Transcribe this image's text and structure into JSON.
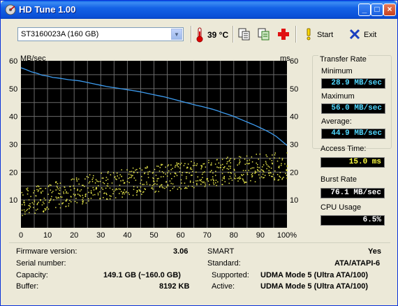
{
  "window": {
    "title": "HD Tune 1.00",
    "min_label": "_",
    "max_label": "□",
    "close_label": "×"
  },
  "toolbar": {
    "drive": "ST3160023A (160 GB)",
    "temperature": "39 °C",
    "start_label": "Start",
    "exit_label": "Exit"
  },
  "chart": {
    "left_unit": "MB/sec",
    "right_unit": "ms",
    "y_ticks": [
      "60",
      "50",
      "40",
      "30",
      "20",
      "10"
    ],
    "x_ticks": [
      "0",
      "10",
      "20",
      "30",
      "40",
      "50",
      "60",
      "70",
      "80",
      "90",
      "100%"
    ]
  },
  "chart_data": {
    "type": "line",
    "x": [
      0,
      2,
      4,
      6,
      8,
      10,
      12,
      14,
      16,
      18,
      20,
      22,
      24,
      26,
      28,
      30,
      32,
      34,
      36,
      38,
      40,
      42,
      44,
      46,
      48,
      50,
      52,
      54,
      56,
      58,
      60,
      62,
      64,
      66,
      68,
      70,
      72,
      74,
      76,
      78,
      80,
      82,
      84,
      86,
      88,
      90,
      92,
      94,
      96,
      98,
      100
    ],
    "series": [
      {
        "name": "Transfer Rate",
        "axis": "MB/sec",
        "values": [
          57.5,
          56.8,
          56.0,
          55.5,
          54.8,
          54.5,
          54.0,
          53.8,
          53.5,
          53.2,
          53.0,
          52.8,
          52.4,
          52.0,
          51.6,
          51.2,
          50.8,
          50.5,
          50.2,
          49.9,
          49.6,
          49.3,
          49.0,
          48.6,
          48.2,
          47.8,
          47.4,
          47.0,
          46.5,
          46.0,
          45.5,
          45.0,
          44.5,
          44.0,
          43.6,
          43.1,
          42.6,
          42.0,
          41.3,
          40.7,
          40.0,
          39.2,
          38.4,
          37.6,
          36.8,
          35.9,
          35.0,
          34.0,
          32.8,
          31.2,
          29.6
        ]
      },
      {
        "name": "Access Time",
        "axis": "ms",
        "values": [
          9.0,
          9.5,
          10.0,
          10.3,
          10.8,
          11.2,
          11.5,
          12.0,
          12.4,
          12.8,
          13.2,
          13.5,
          14.0,
          14.3,
          14.6,
          15.0,
          15.3,
          15.6,
          15.9,
          16.2,
          16.5,
          16.8,
          17.0,
          17.3,
          17.6,
          17.8,
          18.0,
          18.2,
          18.5,
          18.8,
          19.0,
          19.2,
          19.4,
          19.6,
          19.8,
          20.0,
          20.2,
          20.4,
          20.6,
          20.8,
          21.0,
          21.2,
          21.3,
          21.5,
          21.7,
          21.8,
          22.0,
          22.1,
          22.2,
          22.3,
          22.4
        ]
      }
    ],
    "ylim": [
      0,
      60
    ],
    "xlim": [
      0,
      100
    ],
    "ylabel": "MB/sec",
    "y2label": "ms",
    "grid": true
  },
  "side": {
    "transfer_rate_title": "Transfer Rate",
    "minimum_label": "Minimum",
    "minimum_value": "28.9 MB/sec",
    "maximum_label": "Maximum",
    "maximum_value": "56.0 MB/sec",
    "average_label": "Average:",
    "average_value": "44.9 MB/sec",
    "access_label": "Access Time:",
    "access_value": "15.0 ms",
    "burst_label": "Burst Rate",
    "burst_value": "76.1 MB/sec",
    "cpu_label": "CPU Usage",
    "cpu_value": "6.5%"
  },
  "info": {
    "firmware_label": "Firmware version:",
    "firmware_value": "3.06",
    "serial_label": "Serial number:",
    "serial_value": "",
    "capacity_label": "Capacity:",
    "capacity_value": "149.1 GB (~160.0 GB)",
    "buffer_label": "Buffer:",
    "buffer_value": "8192 KB",
    "smart_label": "SMART",
    "smart_value": "Yes",
    "standard_label": "Standard:",
    "standard_value": "ATA/ATAPI-6",
    "supported_label": "Supported:",
    "supported_value": "UDMA Mode 5 (Ultra ATA/100)",
    "active_label": "Active:",
    "active_value": "UDMA Mode 5 (Ultra ATA/100)"
  }
}
